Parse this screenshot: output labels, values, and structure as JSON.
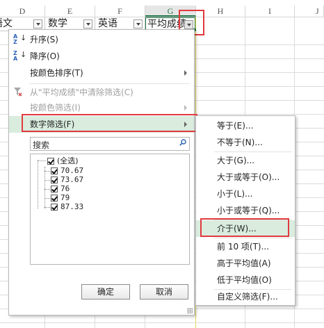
{
  "columns": [
    {
      "letter": "D",
      "header": "语文"
    },
    {
      "letter": "E",
      "header": "数学"
    },
    {
      "letter": "F",
      "header": "英语"
    },
    {
      "letter": "G",
      "header": "平均成绩"
    },
    {
      "letter": "H",
      "header": ""
    },
    {
      "letter": "I",
      "header": ""
    },
    {
      "letter": "J",
      "header": ""
    }
  ],
  "menu": {
    "sort_asc": "升序(S)",
    "sort_desc": "降序(O)",
    "sort_color": "按颜色排序(T)",
    "clear_filter": "从\"平均成绩\"中清除筛选(C)",
    "filter_color": "按颜色筛选(I)",
    "number_filter": "数字筛选(F)"
  },
  "search": {
    "placeholder": "搜索"
  },
  "values": [
    {
      "label": "(全选)",
      "checked": true
    },
    {
      "label": "70.67",
      "checked": true
    },
    {
      "label": "73.67",
      "checked": true
    },
    {
      "label": "76",
      "checked": true
    },
    {
      "label": "79",
      "checked": true
    },
    {
      "label": "87.33",
      "checked": true
    }
  ],
  "buttons": {
    "ok": "确定",
    "cancel": "取消"
  },
  "submenu": [
    "等于(E)...",
    "不等于(N)...",
    "大于(G)...",
    "大于或等于(O)...",
    "小于(L)...",
    "小于或等于(Q)...",
    "介于(W)...",
    "前 10 项(T)...",
    "高于平均值(A)",
    "低于平均值(O)",
    "自定义筛选(F)..."
  ],
  "colors": {
    "highlight": "#d9ecde",
    "callout": "#e0393e",
    "excel_green": "#217346"
  }
}
